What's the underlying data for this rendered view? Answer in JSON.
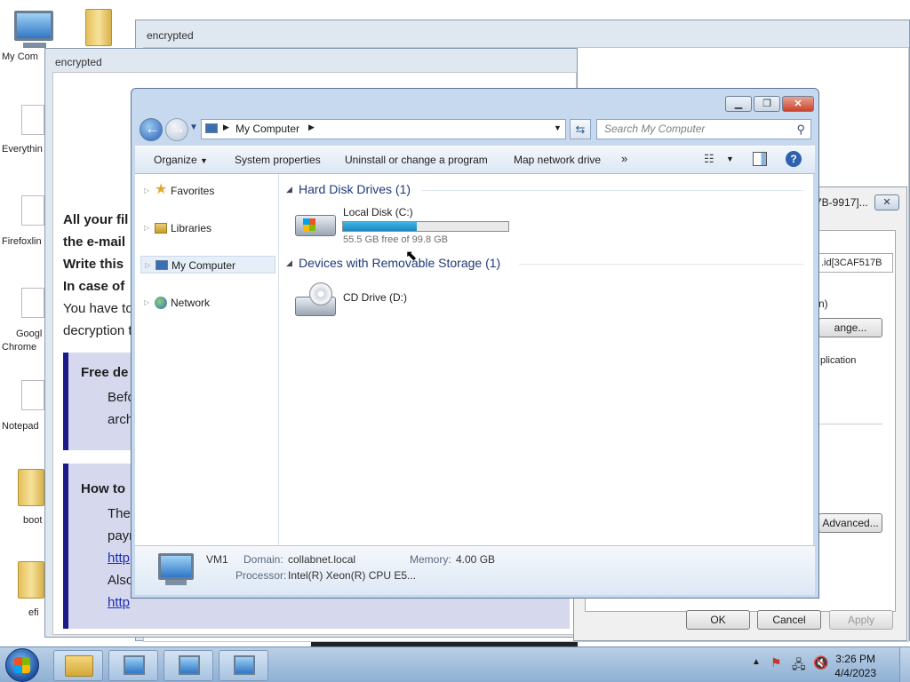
{
  "desktop": {
    "icons": [
      {
        "label": "My Com"
      },
      {
        "label": "Everythin"
      },
      {
        "label": "Firefoxlin"
      },
      {
        "label": "Googl"
      },
      {
        "label": "Chrome"
      },
      {
        "label": "Notepad"
      },
      {
        "label": "boot"
      },
      {
        "label": "efi"
      }
    ]
  },
  "back_window": {
    "title": "encrypted"
  },
  "note_window": {
    "title": "encrypted",
    "lines": [
      "All your fil",
      "the e-mail",
      "Write this",
      "In case of",
      "You have to",
      "decryption t"
    ],
    "box1": {
      "title": "Free de",
      "l1": "Befo",
      "l2": "arch"
    },
    "box2": {
      "title": "How to",
      "l1": "The",
      "l2": "payr",
      "l3": "http",
      "l4": "Also",
      "l5": "http"
    }
  },
  "sysprops": {
    "title_partial": "7B-9917]...",
    "id_partial": ".id[3CAF517B",
    "line_n": "n)",
    "change_btn": "ange...",
    "application": "plication",
    "advanced_btn": "Advanced...",
    "ok": "OK",
    "cancel": "Cancel",
    "apply": "Apply"
  },
  "explorer": {
    "breadcrumb": "My Computer",
    "search_placeholder": "Search My Computer",
    "toolbar": {
      "organize": "Organize",
      "system_properties": "System properties",
      "uninstall": "Uninstall or change a program",
      "map_drive": "Map network drive",
      "more": "»"
    },
    "nav": {
      "favorites": "Favorites",
      "libraries": "Libraries",
      "my_computer": "My Computer",
      "network": "Network"
    },
    "groups": {
      "hdd": "Hard Disk Drives (1)",
      "removable": "Devices with Removable Storage (1)"
    },
    "local_disk": {
      "name": "Local Disk (C:)",
      "free_text": "55.5 GB free of 99.8 GB",
      "used_fraction": 0.444
    },
    "cd_drive": {
      "name": "CD Drive (D:)"
    },
    "details": {
      "computer_name": "VM1",
      "domain_label": "Domain:",
      "domain_value": "collabnet.local",
      "memory_label": "Memory:",
      "memory_value": "4.00 GB",
      "processor_label": "Processor:",
      "processor_value": "Intel(R) Xeon(R) CPU E5..."
    }
  },
  "taskbar": {
    "time": "3:26 PM",
    "date": "4/4/2023"
  },
  "colors": {
    "accent": "#1c1a8a",
    "disk_bar": "#26a0da",
    "group_header": "#1e3a78"
  }
}
